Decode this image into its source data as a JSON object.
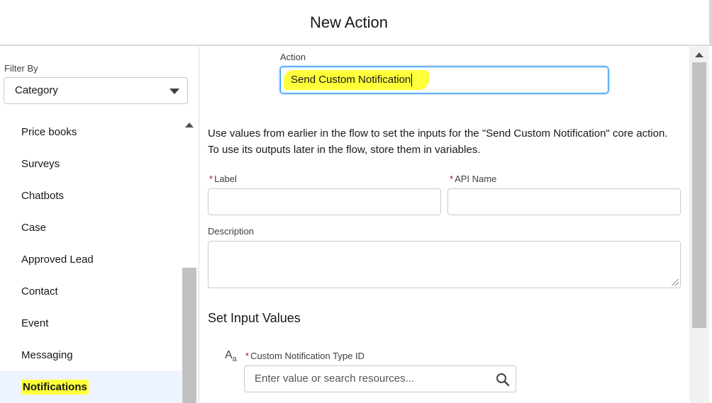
{
  "header": {
    "title": "New Action"
  },
  "sidebar": {
    "filter_label": "Filter By",
    "filter_value": "Category",
    "categories": [
      {
        "label": "Price books",
        "selected": false
      },
      {
        "label": "Surveys",
        "selected": false
      },
      {
        "label": "Chatbots",
        "selected": false
      },
      {
        "label": "Case",
        "selected": false
      },
      {
        "label": "Approved Lead",
        "selected": false
      },
      {
        "label": "Contact",
        "selected": false
      },
      {
        "label": "Event",
        "selected": false
      },
      {
        "label": "Messaging",
        "selected": false
      },
      {
        "label": "Notifications",
        "selected": true
      }
    ]
  },
  "main": {
    "action_label": "Action",
    "action_value": "Send Custom Notification",
    "description": "Use values from earlier in the flow to set the inputs for the \"Send Custom Notification\" core action. To use its outputs later in the flow, store them in variables.",
    "label_field": {
      "label": "Label",
      "required_mark": "*",
      "value": ""
    },
    "api_name_field": {
      "label": "API Name",
      "required_mark": "*",
      "value": ""
    },
    "description_field": {
      "label": "Description",
      "value": ""
    },
    "section_title": "Set Input Values",
    "input_type_icon_main": "A",
    "input_type_icon_sub": "a",
    "notification_type": {
      "label": "Custom Notification Type ID",
      "required_mark": "*",
      "placeholder": "Enter value or search resources..."
    }
  },
  "icons": {
    "search": "search-icon",
    "text_type": "text-type-icon",
    "dropdown": "chevron-down-icon"
  },
  "colors": {
    "highlight": "#ffff3a",
    "focus_border": "#1b96ff",
    "required": "#ba0517",
    "selected_bg": "#eef4ff"
  }
}
